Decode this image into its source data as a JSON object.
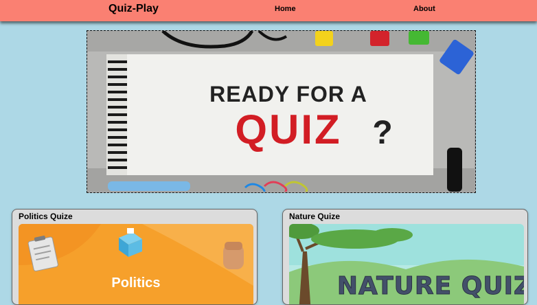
{
  "navbar": {
    "brand": "Quiz-Play",
    "links": [
      {
        "label": "Home"
      },
      {
        "label": "About"
      }
    ]
  },
  "hero": {
    "line1": "READY FOR A",
    "line2": "QUIZ",
    "mark": "?"
  },
  "cards": [
    {
      "title": "Politics Quize",
      "image_text": "Politics"
    },
    {
      "title": "Nature Quize",
      "image_text": "NATURE QUIZ"
    }
  ],
  "colors": {
    "background": "#add8e6",
    "navbar": "#fa8072",
    "card": "#dcdcdc",
    "quiz_red": "#d21d24",
    "politics_orange": "#f6a02b"
  }
}
